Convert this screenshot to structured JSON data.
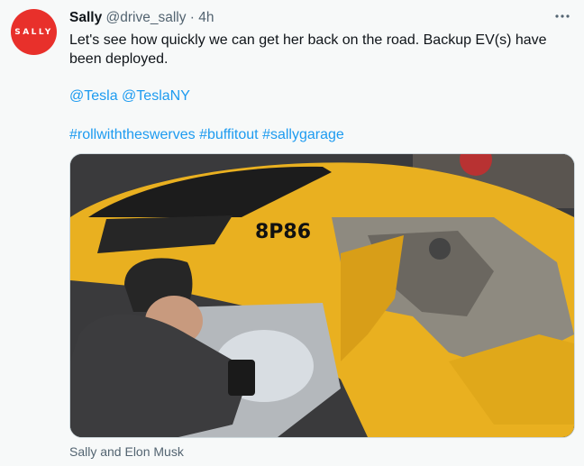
{
  "tweet": {
    "avatar_text": "SALLY",
    "name": "Sally",
    "handle": "@drive_sally",
    "separator": "·",
    "time": "4h",
    "more_icon": "more-icon",
    "text": "Let's see how quickly we can get her back on the road. Backup EV(s) have been deployed.",
    "mentions": [
      "@Tesla",
      "@TeslaNY"
    ],
    "hashtags": [
      "#rollwiththeswerves",
      "#buffitout",
      "#sallygarage"
    ],
    "media": {
      "plate_text": "8P86",
      "caption": "Sally and Elon Musk"
    }
  },
  "colors": {
    "avatar_bg": "#e8302b",
    "link": "#1d9bf0",
    "secondary_text": "#536471",
    "car_yellow": "#e9b020"
  }
}
